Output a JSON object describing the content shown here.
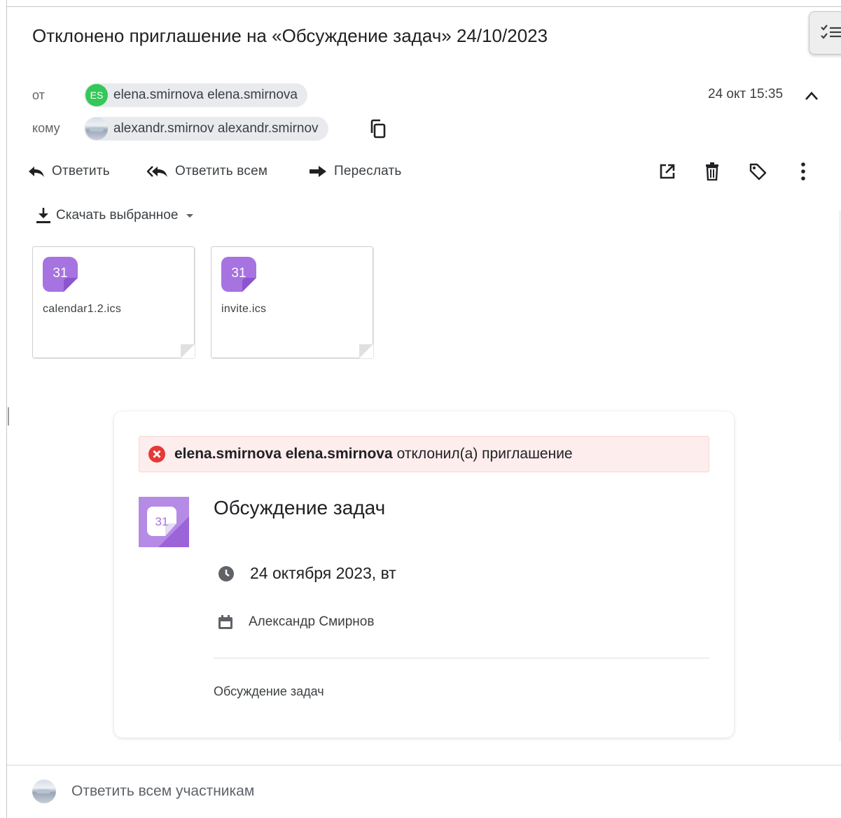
{
  "subject": "Отклонено приглашение на «Обсуждение задач» 24/10/2023",
  "header": {
    "from_label": "от",
    "to_label": "кому",
    "sender": {
      "initials": "ES",
      "name": "elena.smirnova elena.smirnova",
      "avatar_color": "#34c759"
    },
    "recipient": {
      "name": "alexandr.smirnov alexandr.smirnov"
    },
    "date": "24 окт 15:35"
  },
  "actions": {
    "reply": "Ответить",
    "reply_all": "Ответить всем",
    "forward": "Переслать"
  },
  "download_selected": "Скачать выбранное",
  "attachments": [
    {
      "name": "calendar1.2.ics",
      "icon_text": "31"
    },
    {
      "name": "invite.ics",
      "icon_text": "31"
    }
  ],
  "invitation": {
    "status_name": "elena.smirnova elena.smirnova",
    "status_text": "отклонил(а) приглашение",
    "icon_text": "31",
    "title": "Обсуждение задач",
    "date": "24 октября 2023, вт",
    "organizer": "Александр Смирнов",
    "description": "Обсуждение задач"
  },
  "footer": {
    "reply_all_participants": "Ответить всем участникам"
  },
  "colors": {
    "accent_purple": "#a673e0",
    "error_red": "#e53935",
    "alert_bg": "#fdeded"
  }
}
